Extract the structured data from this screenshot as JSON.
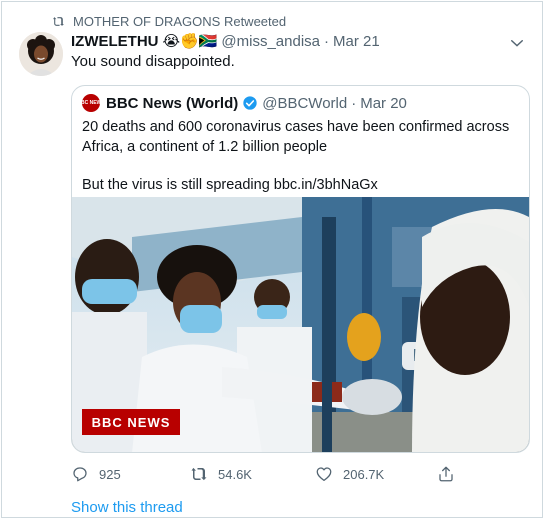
{
  "retweet": {
    "text": "MOTHER OF DRAGONS Retweeted"
  },
  "tweet": {
    "name": "IZWELETHU",
    "emoji": "😭✊🇿🇦",
    "handle": "@miss_andisa",
    "separator": "·",
    "date": "Mar 21",
    "text": "You sound disappointed."
  },
  "quote": {
    "avatar_text": "BBC NEWS",
    "name": "BBC News (World)",
    "handle": "@BBCWorld",
    "separator": "·",
    "date": "Mar 20",
    "paragraph1": "20 deaths and 600 coronavirus cases have been confirmed across Africa, a continent of 1.2 billion people",
    "paragraph2": "But the virus is still spreading bbc.in/3bhNaGx",
    "image_watermark": "BBC NEWS"
  },
  "actions": {
    "reply_count": "925",
    "retweet_count": "54.6K",
    "like_count": "206.7K"
  },
  "show_thread": "Show this thread",
  "colors": {
    "link_blue": "#1d9bf0",
    "muted_gray": "#536471",
    "bbc_red": "#b80000"
  },
  "icons": [
    "retweet-icon",
    "chevron-down-icon",
    "verified-badge-icon",
    "reply-icon",
    "like-icon",
    "share-icon"
  ]
}
